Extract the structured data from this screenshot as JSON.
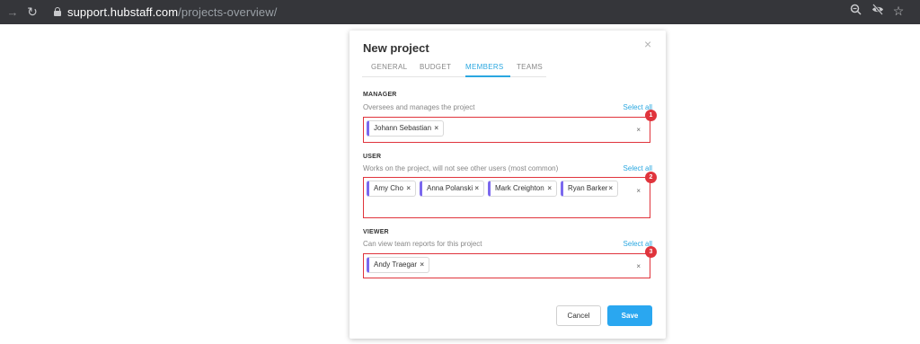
{
  "browser": {
    "url_domain": "support.hubstaff.com",
    "url_path": "/projects-overview/",
    "icons": [
      "back-arrow-icon",
      "reload-icon",
      "lock-icon",
      "zoom-icon",
      "eye-off-icon",
      "star-icon"
    ]
  },
  "modal": {
    "title": "New project",
    "tabs": [
      "GENERAL",
      "BUDGET",
      "MEMBERS",
      "TEAMS"
    ],
    "active_tab": "MEMBERS",
    "sections": {
      "manager": {
        "label": "MANAGER",
        "description": "Oversees and manages the project",
        "select_all": "Select all",
        "members": [
          "Johann Sebastian"
        ],
        "badge": "1"
      },
      "user": {
        "label": "USER",
        "description": "Works on the project, will not see other users (most common)",
        "select_all": "Select all",
        "members": [
          "Amy Cho",
          "Anna Polanski",
          "Mark Creighton",
          "Ryan Barker"
        ],
        "badge": "2"
      },
      "viewer": {
        "label": "VIEWER",
        "description": "Can view team reports for this project",
        "select_all": "Select all",
        "members": [
          "Andy Traegar"
        ],
        "badge": "3"
      }
    },
    "chip_remove": "×",
    "clear": "×",
    "close": "×",
    "cancel_label": "Cancel",
    "save_label": "Save"
  },
  "colors": {
    "accent": "#2aa7e0",
    "chip_border": "#7b68ee",
    "highlight": "#e0343c"
  }
}
